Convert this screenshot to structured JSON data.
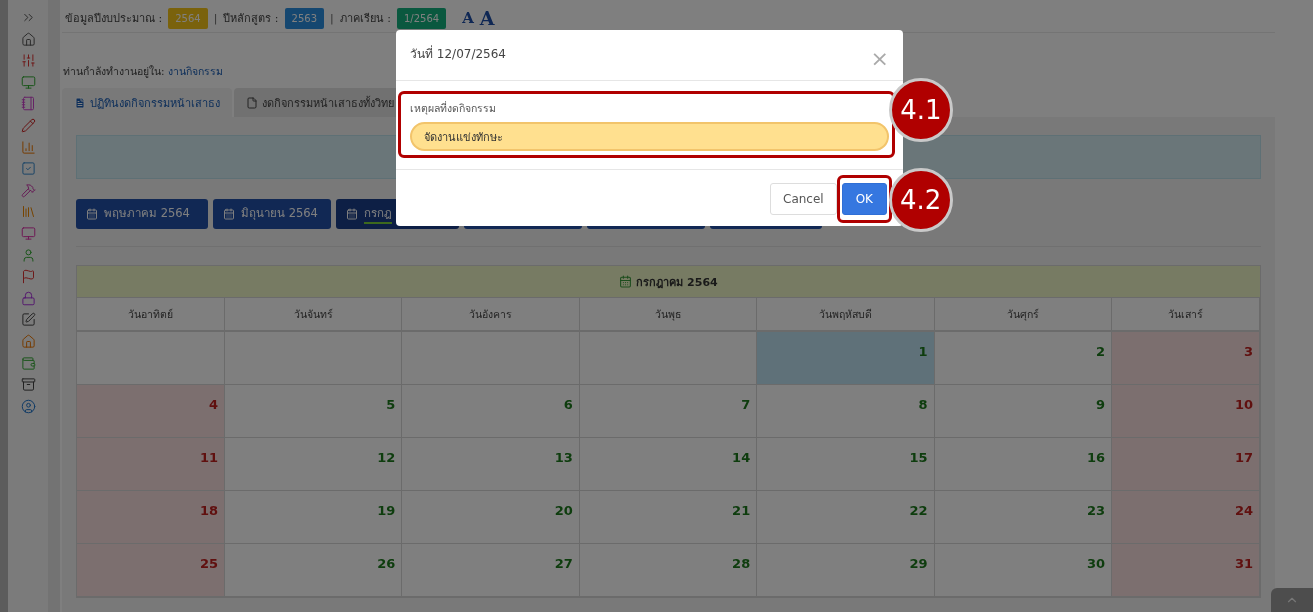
{
  "header": {
    "fields": [
      {
        "label": "ข้อมูลปีงบประมาณ :",
        "value": "2564",
        "kind": "warning"
      },
      {
        "separator": "|",
        "label": "ปีหลักสูตร :",
        "value": "2563",
        "kind": "primary"
      },
      {
        "separator": "|",
        "label": "ภาคเรียน :",
        "value": "1/2564",
        "kind": "success"
      }
    ],
    "font_buttons": [
      "A",
      "A"
    ]
  },
  "breadcrumb": {
    "prefix": "ท่านกำลังทำงานอยู่ใน:",
    "link": "งานกิจกรรม"
  },
  "tabs": [
    {
      "label": "ปฏิทินงดกิจกรรมหน้าเสาธง",
      "selected": true
    },
    {
      "label": "งดกิจกรรมหน้าเสาธงทั้งวิทย",
      "selected": false
    }
  ],
  "month_buttons": [
    {
      "label": "พฤษภาคม 2564",
      "selected": false
    },
    {
      "label": "มิถุนายน 2564",
      "selected": false
    },
    {
      "label": "กรกฎ",
      "selected": true
    }
  ],
  "calendar": {
    "title": "กรกฎาคม 2564",
    "weekdays": [
      "วันอาทิตย์",
      "วันจันทร์",
      "วันอังคาร",
      "วันพุธ",
      "วันพฤหัสบดี",
      "วันศุกร์",
      "วันเสาร์"
    ],
    "weeks": [
      [
        {
          "holiday": false,
          "today": false
        },
        {
          "holiday": false,
          "today": false
        },
        {
          "holiday": false,
          "today": false
        },
        {
          "holiday": false,
          "today": false
        },
        {
          "day": "1",
          "holiday": false,
          "today": true
        },
        {
          "day": "2",
          "holiday": false,
          "today": false
        },
        {
          "day": "3",
          "holiday": true,
          "today": false
        }
      ],
      [
        {
          "day": "4",
          "holiday": true,
          "today": false
        },
        {
          "day": "5",
          "holiday": false,
          "today": false
        },
        {
          "day": "6",
          "holiday": false,
          "today": false
        },
        {
          "day": "7",
          "holiday": false,
          "today": false
        },
        {
          "day": "8",
          "holiday": false,
          "today": false
        },
        {
          "day": "9",
          "holiday": false,
          "today": false
        },
        {
          "day": "10",
          "holiday": true,
          "today": false
        }
      ],
      [
        {
          "day": "11",
          "holiday": true,
          "today": false
        },
        {
          "day": "12",
          "holiday": false,
          "today": false
        },
        {
          "day": "13",
          "holiday": false,
          "today": false
        },
        {
          "day": "14",
          "holiday": false,
          "today": false
        },
        {
          "day": "15",
          "holiday": false,
          "today": false
        },
        {
          "day": "16",
          "holiday": false,
          "today": false
        },
        {
          "day": "17",
          "holiday": true,
          "today": false
        }
      ],
      [
        {
          "day": "18",
          "holiday": true,
          "today": false
        },
        {
          "day": "19",
          "holiday": false,
          "today": false
        },
        {
          "day": "20",
          "holiday": false,
          "today": false
        },
        {
          "day": "21",
          "holiday": false,
          "today": false
        },
        {
          "day": "22",
          "holiday": false,
          "today": false
        },
        {
          "day": "23",
          "holiday": false,
          "today": false
        },
        {
          "day": "24",
          "holiday": true,
          "today": false
        }
      ],
      [
        {
          "day": "25",
          "holiday": true,
          "today": false
        },
        {
          "day": "26",
          "holiday": false,
          "today": false
        },
        {
          "day": "27",
          "holiday": false,
          "today": false
        },
        {
          "day": "28",
          "holiday": false,
          "today": false
        },
        {
          "day": "29",
          "holiday": false,
          "today": false
        },
        {
          "day": "30",
          "holiday": false,
          "today": false
        },
        {
          "day": "31",
          "holiday": true,
          "today": false
        }
      ]
    ]
  },
  "modal": {
    "title": "วันที่ 12/07/2564",
    "close": "×",
    "field": {
      "label": "เหตุผลที่งดกิจกรรม",
      "value": "จัดงานแข่งทักษะ",
      "callout": "4.1"
    },
    "buttons": [
      {
        "label": "Cancel",
        "kind": "secondary"
      },
      {
        "label": "OK",
        "kind": "primary",
        "callout": "4.2"
      }
    ]
  }
}
